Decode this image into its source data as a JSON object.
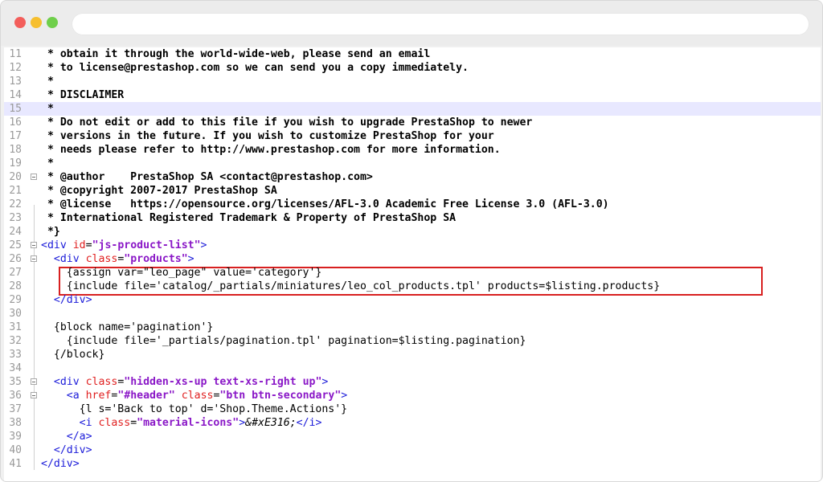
{
  "window": {
    "traffic_lights": [
      "close",
      "minimize",
      "maximize"
    ],
    "address": ""
  },
  "editor": {
    "lines": [
      {
        "n": "11",
        "text": " * obtain it through the world-wide-web, please send an email"
      },
      {
        "n": "12",
        "text": " * to license@prestashop.com so we can send you a copy immediately."
      },
      {
        "n": "13",
        "text": " *"
      },
      {
        "n": "14",
        "text": " * DISCLAIMER"
      },
      {
        "n": "15",
        "text": " *"
      },
      {
        "n": "16",
        "text": " * Do not edit or add to this file if you wish to upgrade PrestaShop to newer"
      },
      {
        "n": "17",
        "text": " * versions in the future. If you wish to customize PrestaShop for your"
      },
      {
        "n": "18",
        "text": " * needs please refer to http://www.prestashop.com for more information."
      },
      {
        "n": "19",
        "text": " *"
      },
      {
        "n": "20",
        "text": " * @author    PrestaShop SA <contact@prestashop.com>"
      },
      {
        "n": "21",
        "text": " * @copyright 2007-2017 PrestaShop SA"
      },
      {
        "n": "22",
        "text": " * @license   https://opensource.org/licenses/AFL-3.0 Academic Free License 3.0 (AFL-3.0)"
      },
      {
        "n": "23",
        "text": " * International Registered Trademark & Property of PrestaShop SA"
      },
      {
        "n": "24",
        "text": " *}"
      },
      {
        "n": "25",
        "text": "<div id=\"js-product-list\">"
      },
      {
        "n": "26",
        "text": "  <div class=\"products\">"
      },
      {
        "n": "27",
        "text": "    {assign var=\"leo_page\" value='category'}"
      },
      {
        "n": "28",
        "text": "    {include file='catalog/_partials/miniatures/leo_col_products.tpl' products=$listing.products}"
      },
      {
        "n": "29",
        "text": "  </div>"
      },
      {
        "n": "30",
        "text": ""
      },
      {
        "n": "31",
        "text": "  {block name='pagination'}"
      },
      {
        "n": "32",
        "text": "    {include file='_partials/pagination.tpl' pagination=$listing.pagination}"
      },
      {
        "n": "33",
        "text": "  {/block}"
      },
      {
        "n": "34",
        "text": ""
      },
      {
        "n": "35",
        "text": "  <div class=\"hidden-xs-up text-xs-right up\">"
      },
      {
        "n": "36",
        "text": "    <a href=\"#header\" class=\"btn btn-secondary\">"
      },
      {
        "n": "37",
        "text": "      {l s='Back to top' d='Shop.Theme.Actions'}"
      },
      {
        "n": "38",
        "text": "      <i class=\"material-icons\">&#xE316;</i>"
      },
      {
        "n": "39",
        "text": "    </a>"
      },
      {
        "n": "40",
        "text": "  </div>"
      },
      {
        "n": "41",
        "text": "</div>"
      }
    ],
    "highlighted_line": "15",
    "fold_markers": [
      "20",
      "25",
      "26",
      "35",
      "36"
    ],
    "annotation": {
      "color": "#d82020",
      "lines": [
        "27",
        "28"
      ]
    }
  }
}
